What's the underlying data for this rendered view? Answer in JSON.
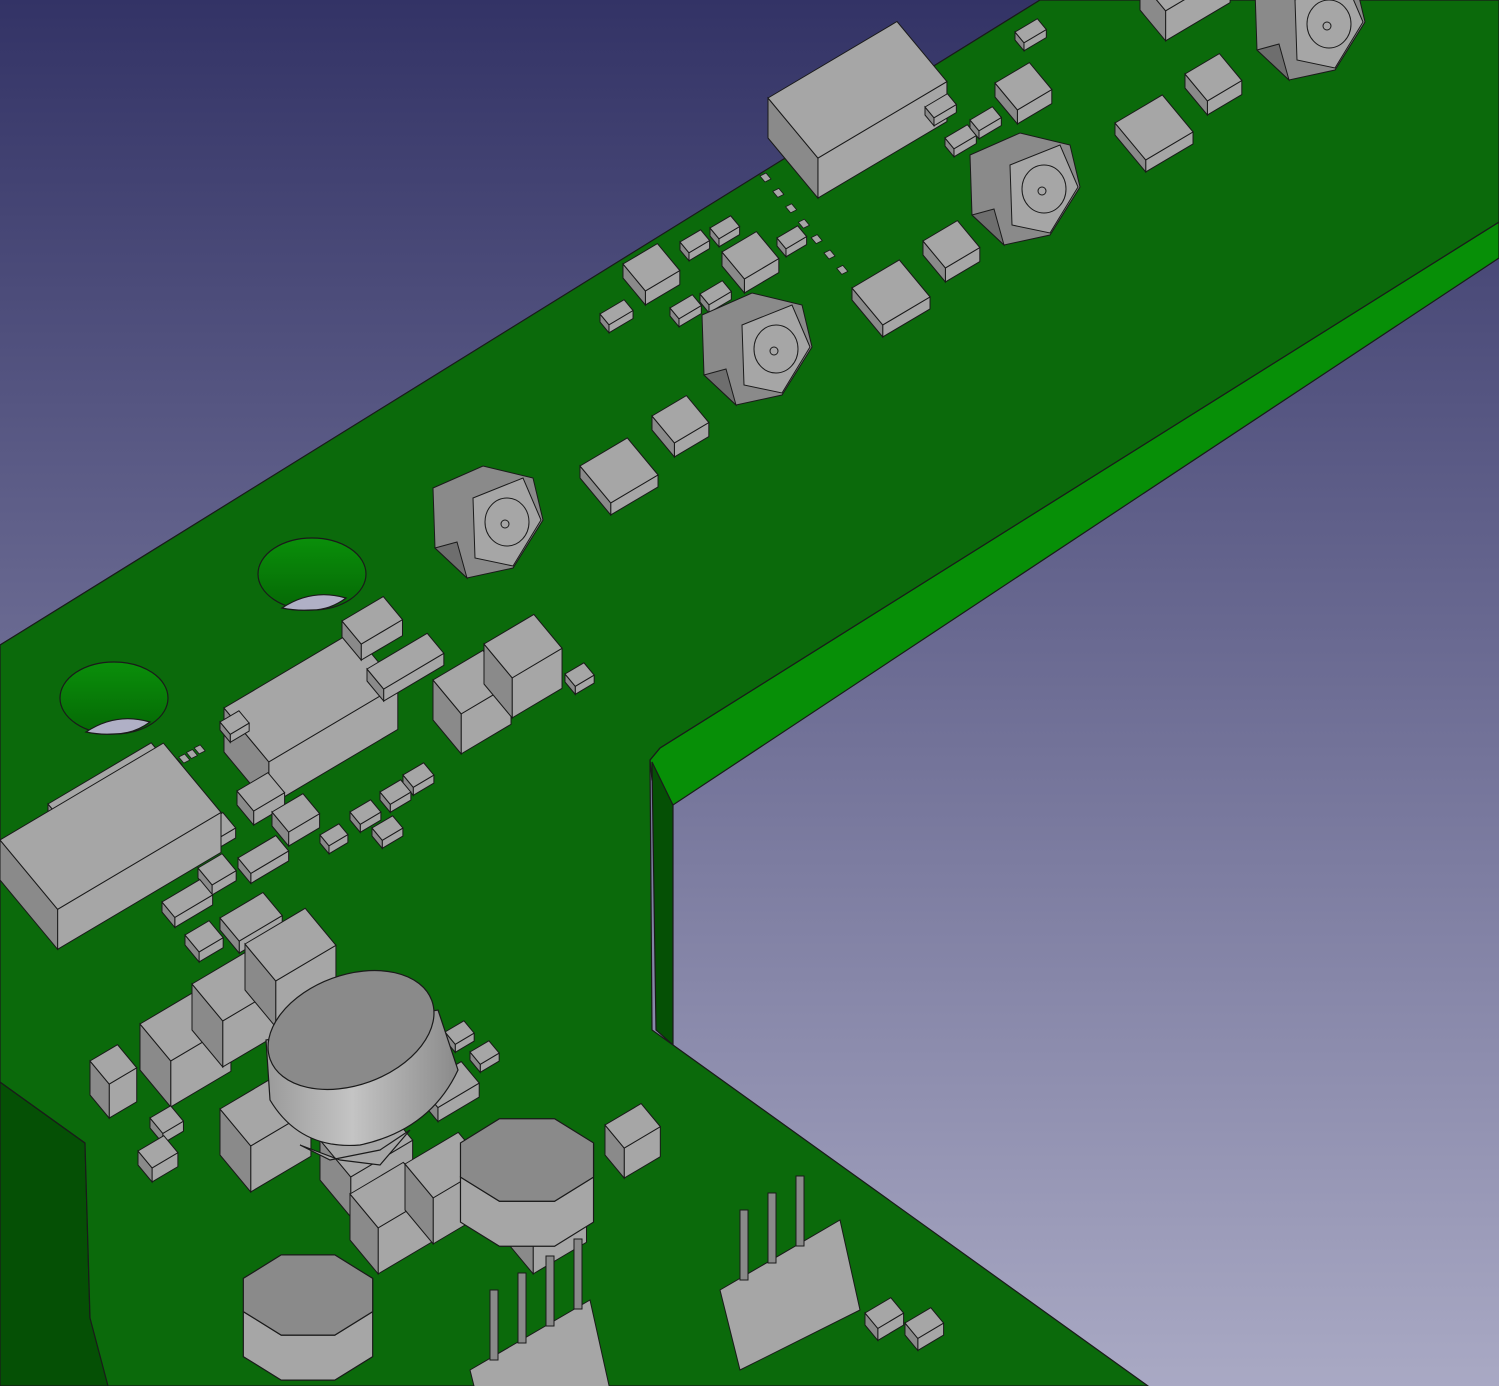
{
  "viewport": {
    "background_top": "#333366",
    "background_bottom": "#a9a9c4"
  },
  "board": {
    "top_color": "#0b6a0b",
    "edge_color": "#078f07",
    "dark_edge_color": "#055005",
    "component_color": "#a6a6a6",
    "component_side_color": "#8a8a8a",
    "component_dark_color": "#6e6e6e",
    "outline_color": "#1a1a1a"
  },
  "components": [
    "ic-soic-top",
    "connector-top-right",
    "connector-center",
    "connector-center-left",
    "connector-left",
    "mounting-hole-1",
    "mounting-hole-2",
    "electrolytic-capacitor",
    "power-inductor-1",
    "power-inductor-2",
    "pin-header-1",
    "pin-header-2",
    "smd-ic-left",
    "crystal-block",
    "usb-connector"
  ]
}
